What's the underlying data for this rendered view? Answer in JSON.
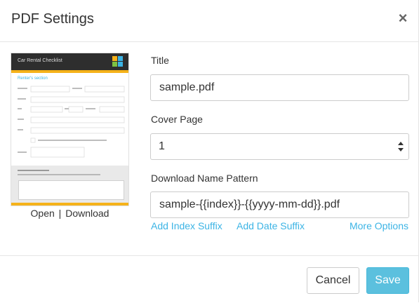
{
  "dialog": {
    "title": "PDF Settings",
    "close_label": "×"
  },
  "preview": {
    "doc_title": "Car Rental Checklist",
    "section_label": "Renter's section",
    "open_label": "Open",
    "separator": "|",
    "download_label": "Download",
    "accent_color": "#f5b21a",
    "header_color": "#2e2e2e"
  },
  "form": {
    "title_label": "Title",
    "title_value": "sample.pdf",
    "cover_label": "Cover Page",
    "cover_value": "1",
    "pattern_label": "Download Name Pattern",
    "pattern_value": "sample-{{index}}-{{yyyy-mm-dd}}.pdf",
    "add_index_label": "Add Index Suffix",
    "add_date_label": "Add Date Suffix",
    "more_options_label": "More Options",
    "link_color": "#3cb4e5"
  },
  "footer": {
    "cancel_label": "Cancel",
    "save_label": "Save",
    "save_color": "#5bc0de"
  }
}
